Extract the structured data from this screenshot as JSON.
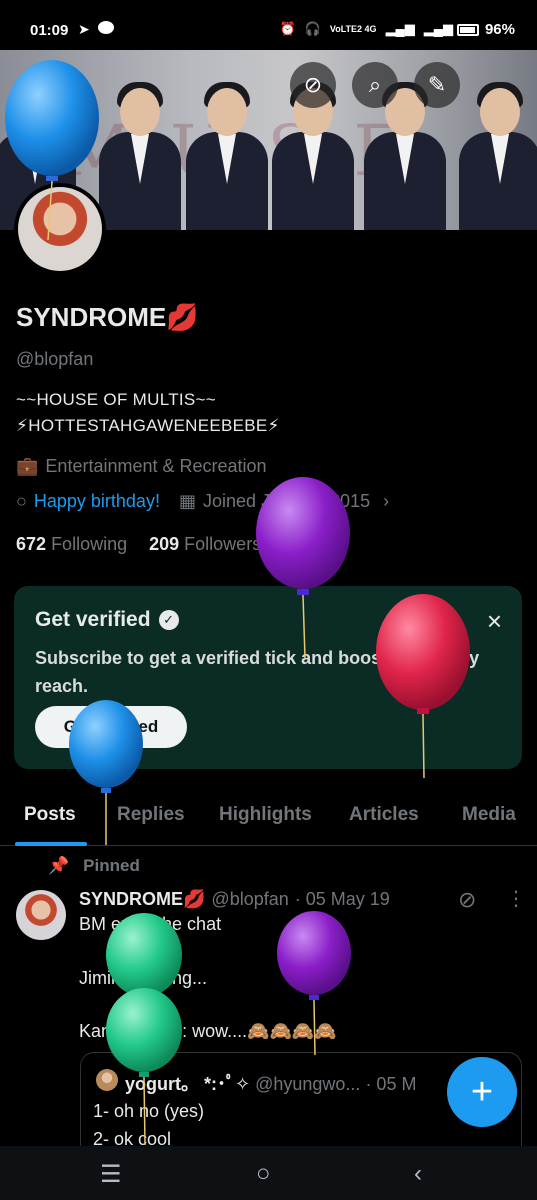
{
  "status_bar": {
    "time": "01:09",
    "left_icons": [
      "telegram-icon",
      "line-icon"
    ],
    "network": "VoLTE2 4G",
    "battery": "96%"
  },
  "profile": {
    "name": "SYNDROME💋",
    "handle": "@blopfan",
    "bio_line1": "~~HOUSE OF MULTIS~~",
    "bio_line2": "⚡HOTTESTAHGAWENEEBEBE⚡",
    "category": "Entertainment & Recreation",
    "birthday_link": "Happy birthday!",
    "joined": "Joined January 2015",
    "following_count": "672",
    "following_label": "Following",
    "followers_count": "209",
    "followers_label": "Followers"
  },
  "verify_card": {
    "title": "Get verified",
    "description": "Subscribe to get a verified tick and boost your reply reach.",
    "button_label": "Get Verified",
    "close_icon": "×"
  },
  "tabs": [
    {
      "label": "Posts",
      "active": true
    },
    {
      "label": "Replies",
      "active": false
    },
    {
      "label": "Highlights",
      "active": false
    },
    {
      "label": "Articles",
      "active": false
    },
    {
      "label": "Media",
      "active": false
    }
  ],
  "pinned_tweet": {
    "pinned_label": "Pinned",
    "author_name": "SYNDROME💋",
    "author_handle": "@blopfan",
    "date": "· 05 May 19",
    "line1": "BM enter the chat",
    "line2": "Jimin is typing...",
    "line3": "Kang Daniel : wow....🙈🙈🙈🙈",
    "quote": {
      "name": "yogurt。 *:･ﾟ✧",
      "handle": "@hyungwo...",
      "date": "· 05 M",
      "line1": "1- oh no (yes)",
      "line2": "2- ok cool"
    }
  },
  "colors": {
    "accent": "#1d9bf0",
    "card_bg": "#0b2c24",
    "muted_text": "#71767b",
    "balloon_blue": "#1e90e8",
    "balloon_purple": "#8a1fc8",
    "balloon_red": "#e0254a",
    "balloon_green": "#22c98a"
  }
}
